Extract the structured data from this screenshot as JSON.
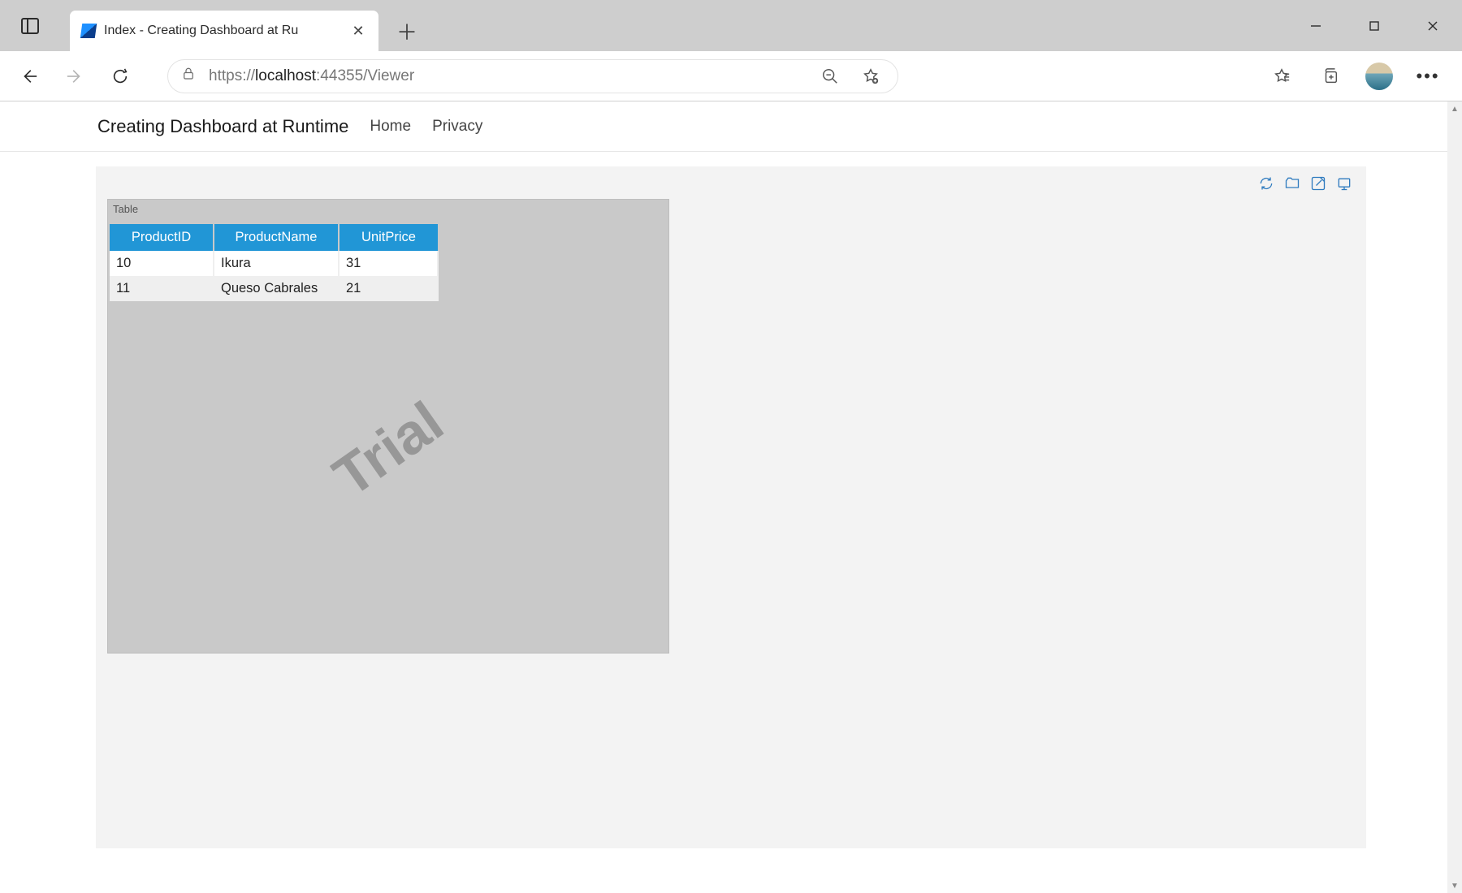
{
  "browser": {
    "tab_title": "Index - Creating Dashboard at Ru",
    "url_scheme": "https://",
    "url_host": "localhost",
    "url_port_path": ":44355/Viewer"
  },
  "page": {
    "title": "Creating Dashboard at Runtime",
    "nav": {
      "home": "Home",
      "privacy": "Privacy"
    }
  },
  "dashboard": {
    "panel_label": "Table",
    "watermark": "Trial",
    "table": {
      "headers": [
        "ProductID",
        "ProductName",
        "UnitPrice"
      ],
      "rows": [
        {
          "ProductID": "10",
          "ProductName": "Ikura",
          "UnitPrice": "31"
        },
        {
          "ProductID": "11",
          "ProductName": "Queso Cabrales",
          "UnitPrice": "21"
        }
      ]
    }
  }
}
